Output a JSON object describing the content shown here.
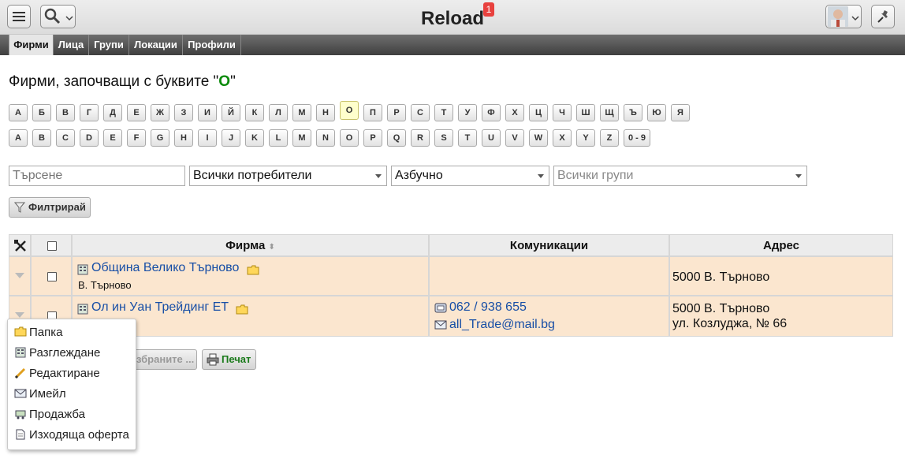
{
  "app": {
    "title": "Reload",
    "notifications": "1"
  },
  "tabs": [
    {
      "label": "Фирми",
      "active": true
    },
    {
      "label": "Лица",
      "active": false
    },
    {
      "label": "Групи",
      "active": false
    },
    {
      "label": "Локации",
      "active": false
    },
    {
      "label": "Профили",
      "active": false
    }
  ],
  "heading": {
    "prefix": "Фирми, започващи с буквите \"",
    "letter": "О",
    "suffix": "\""
  },
  "cyrillic_letters": [
    "А",
    "Б",
    "В",
    "Г",
    "Д",
    "Е",
    "Ж",
    "З",
    "И",
    "Й",
    "К",
    "Л",
    "М",
    "Н",
    "О",
    "П",
    "Р",
    "С",
    "Т",
    "У",
    "Ф",
    "Х",
    "Ц",
    "Ч",
    "Ш",
    "Щ",
    "Ъ",
    "Ю",
    "Я"
  ],
  "latin_letters": [
    "A",
    "B",
    "C",
    "D",
    "E",
    "F",
    "G",
    "H",
    "I",
    "J",
    "K",
    "L",
    "M",
    "N",
    "O",
    "P",
    "Q",
    "R",
    "S",
    "T",
    "U",
    "V",
    "W",
    "X",
    "Y",
    "Z",
    "0 - 9"
  ],
  "selected_letter": "О",
  "filters": {
    "search_placeholder": "Търсене",
    "users": "Всички потребители",
    "order": "Азбучно",
    "groups_placeholder": "Всички групи",
    "filter_button": "Филтрирай"
  },
  "table": {
    "headers": {
      "company": "Фирма",
      "comms": "Комуникации",
      "address": "Адрес"
    },
    "rows": [
      {
        "name": "Община Велико Търново",
        "sub": "В. Търново",
        "phone": "",
        "email": "",
        "addr1": "5000 В. Търново",
        "addr2": ""
      },
      {
        "name": "Ол ин Уан Трейдинг ЕТ",
        "sub": "",
        "phone": "062 / 938 655",
        "email": "all_Trade@mail.bg",
        "addr1": "5000 В. Търново",
        "addr2": "ул. Козлуджа, № 66"
      }
    ]
  },
  "bottom": {
    "selected_label": "збраните ...",
    "print_label": "Печат"
  },
  "context_menu": [
    {
      "label": "Папка",
      "icon": "folder-icon"
    },
    {
      "label": "Разглеждане",
      "icon": "view-icon"
    },
    {
      "label": "Редактиране",
      "icon": "pencil-icon"
    },
    {
      "label": "Имейл",
      "icon": "email-icon"
    },
    {
      "label": "Продажба",
      "icon": "cart-icon"
    },
    {
      "label": "Изходяща оферта",
      "icon": "document-icon"
    }
  ]
}
